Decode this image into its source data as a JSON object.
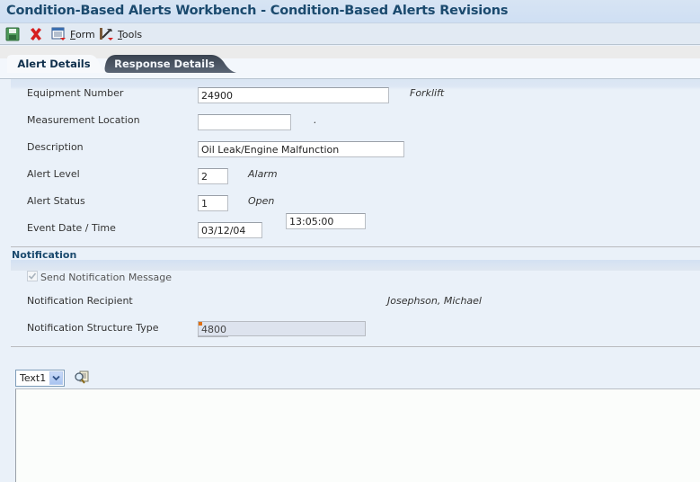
{
  "window": {
    "title": "Condition-Based Alerts Workbench - Condition-Based Alerts Revisions"
  },
  "toolbar": {
    "save_icon": "save-floppy-icon",
    "cancel_icon": "close-x-icon",
    "form_label_ul": "F",
    "form_label_rest": "orm",
    "tools_label_ul": "T",
    "tools_label_rest": "ools"
  },
  "tabs": [
    {
      "label": "Alert Details",
      "active": true
    },
    {
      "label": "Response Details",
      "active": false
    }
  ],
  "form": {
    "equipment_number": {
      "label": "Equipment Number",
      "value": "24900",
      "description": "Forklift"
    },
    "measurement_location": {
      "label": "Measurement Location",
      "value": "",
      "description": "."
    },
    "description": {
      "label": "Description",
      "value": "Oil Leak/Engine Malfunction"
    },
    "alert_level": {
      "label": "Alert Level",
      "value": "2",
      "description": "Alarm"
    },
    "alert_status": {
      "label": "Alert Status",
      "value": "1",
      "description": "Open"
    },
    "event_date_time": {
      "label": "Event Date / Time",
      "date": "03/12/04",
      "time": "13:05:00"
    }
  },
  "notification": {
    "section_title": "Notification",
    "send_message": {
      "label": "Send Notification Message",
      "checked": true,
      "disabled": true
    },
    "recipient": {
      "label": "Notification Recipient",
      "value": "Josephson, Michael"
    },
    "structure_type": {
      "label": "Notification Structure Type",
      "value": "4800"
    }
  },
  "text_panel": {
    "selected_option": "Text1"
  },
  "colors": {
    "title": "#1b4a6e",
    "background": "#eaf1f9",
    "required_marker": "#e07010"
  }
}
